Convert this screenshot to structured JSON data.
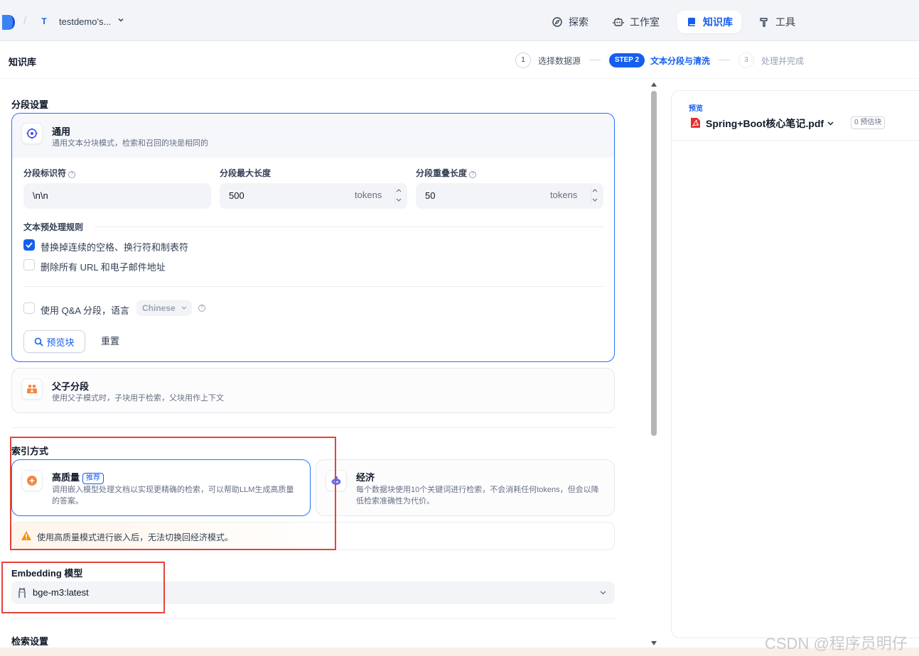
{
  "topbar": {
    "workspace_initial": "T",
    "workspace_name": "testdemo's...",
    "nav": [
      {
        "label": "探索",
        "icon": "compass-icon"
      },
      {
        "label": "工作室",
        "icon": "robot-icon"
      },
      {
        "label": "知识库",
        "icon": "book-icon",
        "active": true
      },
      {
        "label": "工具",
        "icon": "hammer-icon"
      }
    ]
  },
  "page": {
    "title": "知识库"
  },
  "steps": [
    {
      "num": "1",
      "label": "选择数据源"
    },
    {
      "num": "STEP 2",
      "label": "文本分段与清洗",
      "active": true
    },
    {
      "num": "3",
      "label": "处理并完成"
    }
  ],
  "segmentation": {
    "section_title": "分段设置",
    "general": {
      "title": "通用",
      "desc": "通用文本分块模式，检索和召回的块是相同的",
      "fields": {
        "separator_label": "分段标识符",
        "separator_value": "\\n\\n",
        "max_length_label": "分段最大长度",
        "max_length_value": "500",
        "overlap_label": "分段重叠长度",
        "overlap_value": "50",
        "unit": "tokens"
      },
      "preprocess_title": "文本预处理规则",
      "rules": [
        {
          "label": "替换掉连续的空格、换行符和制表符",
          "checked": true
        },
        {
          "label": "删除所有 URL 和电子邮件地址",
          "checked": false
        }
      ],
      "qa_label": "使用 Q&A 分段，语言",
      "qa_language": "Chinese",
      "preview_button": "预览块",
      "reset_button": "重置"
    },
    "parent_child": {
      "title": "父子分段",
      "desc": "使用父子模式时，子块用于检索，父块用作上下文"
    }
  },
  "index": {
    "section_title": "索引方式",
    "high_quality": {
      "title": "高质量",
      "badge": "推荐",
      "desc": "调用嵌入模型处理文档以实现更精确的检索，可以帮助LLM生成高质量的答案。"
    },
    "economy": {
      "title": "经济",
      "desc": "每个数据块使用10个关键词进行检索，不会消耗任何tokens，但会以降低检索准确性为代价。"
    },
    "warning": "使用高质量模式进行嵌入后，无法切换回经济模式。"
  },
  "embedding": {
    "section_title": "Embedding 模型",
    "model": "bge-m3:latest"
  },
  "retrieval": {
    "section_title": "检索设置"
  },
  "preview": {
    "label": "预览",
    "file_name": "Spring+Boot核心笔记.pdf",
    "chunk_count": "0 预估块"
  },
  "watermark": "CSDN @程序员明仔",
  "colors": {
    "accent": "#155eef",
    "highlight_box": "#e5433b",
    "warning": "#f79009"
  }
}
